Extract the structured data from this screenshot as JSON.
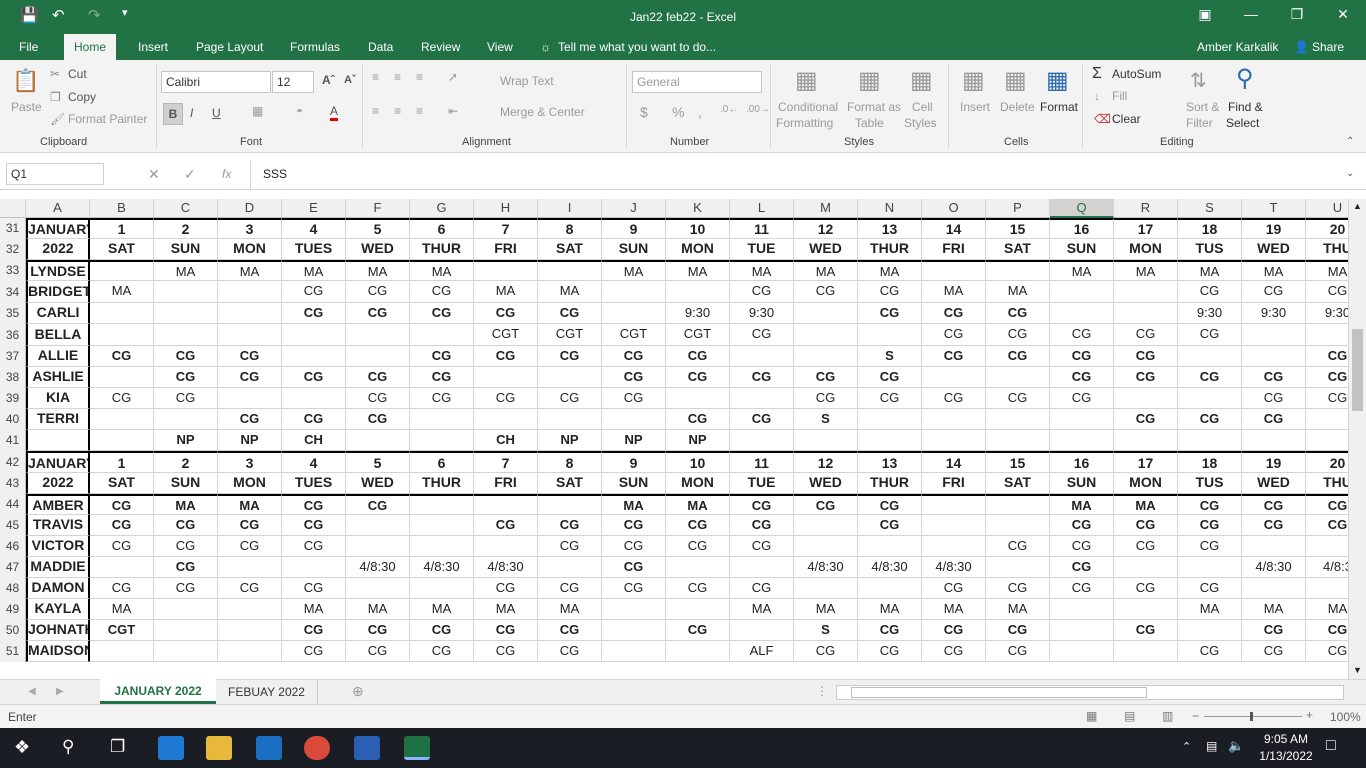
{
  "title": "Jan22 feb22 - Excel",
  "menu_tabs": [
    "File",
    "Home",
    "Insert",
    "Page Layout",
    "Formulas",
    "Data",
    "Review",
    "View"
  ],
  "tell_me": "Tell me what you want to do...",
  "user": "Amber Karkalik",
  "share": "Share",
  "clipboard": {
    "paste": "Paste",
    "cut": "Cut",
    "copy": "Copy",
    "format_painter": "Format Painter",
    "group": "Clipboard"
  },
  "font": {
    "name": "Calibri",
    "size": "12",
    "group": "Font",
    "bold": "B",
    "italic": "I",
    "underline": "U"
  },
  "alignment": {
    "wrap": "Wrap Text",
    "merge": "Merge & Center",
    "group": "Alignment"
  },
  "number": {
    "format": "General",
    "group": "Number",
    "dollar": "$",
    "percent": "%",
    "comma": ","
  },
  "styles": {
    "conditional": "Conditional",
    "formatting": "Formatting",
    "format_as": "Format as",
    "table": "Table",
    "cell": "Cell",
    "cell_styles": "Styles",
    "group": "Styles"
  },
  "cells": {
    "insert": "Insert",
    "delete": "Delete",
    "format": "Format",
    "group": "Cells"
  },
  "editing": {
    "autosum": "AutoSum",
    "fill": "Fill",
    "clear": "Clear",
    "sort": "Sort &",
    "filter": "Filter",
    "find": "Find &",
    "select": "Select",
    "group": "Editing"
  },
  "namebox": "Q1",
  "fx": "fx",
  "formula": "SSS",
  "columns": [
    "A",
    "B",
    "C",
    "D",
    "E",
    "F",
    "G",
    "H",
    "I",
    "J",
    "K",
    "L",
    "M",
    "N",
    "O",
    "P",
    "Q",
    "R",
    "S",
    "T",
    "U"
  ],
  "selected_column": "Q",
  "rows": [
    {
      "n": "31",
      "hdr": true,
      "thick": true,
      "c": [
        "JANUARY",
        "1",
        "2",
        "3",
        "4",
        "5",
        "6",
        "7",
        "8",
        "9",
        "10",
        "11",
        "12",
        "13",
        "14",
        "15",
        "16",
        "17",
        "18",
        "19",
        "20"
      ]
    },
    {
      "n": "32",
      "hdr": true,
      "c": [
        "2022",
        "SAT",
        "SUN",
        "MON",
        "TUES",
        "WED",
        "THUR",
        "FRI",
        "SAT",
        "SUN",
        "MON",
        "TUE",
        "WED",
        "THUR",
        "FRI",
        "SAT",
        "SUN",
        "MON",
        "TUS",
        "WED",
        "THU"
      ]
    },
    {
      "n": "33",
      "thick": true,
      "c": [
        "LYNDSE",
        "",
        "MA",
        "MA",
        "MA",
        "MA",
        "MA",
        "",
        "",
        "MA",
        "MA",
        "MA",
        "MA",
        "MA",
        "",
        "",
        "MA",
        "MA",
        "MA",
        "MA",
        "MA"
      ]
    },
    {
      "n": "34",
      "c": [
        "BRIDGET",
        "MA",
        "",
        "",
        "CG",
        "CG",
        "CG",
        "MA",
        "MA",
        "",
        "",
        "CG",
        "CG",
        "CG",
        "MA",
        "MA",
        "",
        "",
        "CG",
        "CG",
        "CG"
      ]
    },
    {
      "n": "35",
      "c": [
        "CARLI",
        "",
        "",
        "",
        "CG",
        "CG",
        "CG",
        "CG",
        "CG",
        "",
        "9:30",
        "9:30",
        "",
        "CG",
        "CG",
        "CG",
        "",
        "",
        "9:30",
        "9:30",
        "9:30"
      ]
    },
    {
      "n": "36",
      "c": [
        "BELLA",
        "",
        "",
        "",
        "",
        "",
        "",
        "CGT",
        "CGT",
        "CGT",
        "CGT",
        "CG",
        "",
        "",
        "CG",
        "CG",
        "CG",
        "CG",
        "CG",
        "",
        ""
      ]
    },
    {
      "n": "37",
      "c": [
        "ALLIE",
        "CG",
        "CG",
        "CG",
        "",
        "",
        "CG",
        "CG",
        "CG",
        "CG",
        "CG",
        "",
        "",
        "S",
        "CG",
        "CG",
        "CG",
        "CG",
        "",
        "",
        "CG"
      ]
    },
    {
      "n": "38",
      "c": [
        "ASHLIE",
        "",
        "CG",
        "CG",
        "CG",
        "CG",
        "CG",
        "",
        "",
        "CG",
        "CG",
        "CG",
        "CG",
        "CG",
        "",
        "",
        "CG",
        "CG",
        "CG",
        "CG",
        "CG"
      ]
    },
    {
      "n": "39",
      "c": [
        "KIA",
        "CG",
        "CG",
        "",
        "",
        "CG",
        "CG",
        "CG",
        "CG",
        "CG",
        "",
        "",
        "CG",
        "CG",
        "CG",
        "CG",
        "CG",
        "",
        "",
        "CG",
        "CG"
      ]
    },
    {
      "n": "40",
      "c": [
        "TERRI",
        "",
        "",
        "CG",
        "CG",
        "CG",
        "",
        "",
        "",
        "",
        "CG",
        "CG",
        "S",
        "",
        "",
        "",
        "",
        "CG",
        "CG",
        "CG",
        ""
      ]
    },
    {
      "n": "41",
      "c": [
        "",
        "",
        "NP",
        "NP",
        "CH",
        "",
        "",
        "CH",
        "NP",
        "NP",
        "NP",
        "",
        "",
        "",
        "",
        "",
        "",
        "",
        "",
        "",
        ""
      ]
    },
    {
      "n": "42",
      "hdr": true,
      "thick": true,
      "c": [
        "JANUARY",
        "1",
        "2",
        "3",
        "4",
        "5",
        "6",
        "7",
        "8",
        "9",
        "10",
        "11",
        "12",
        "13",
        "14",
        "15",
        "16",
        "17",
        "18",
        "19",
        "20"
      ]
    },
    {
      "n": "43",
      "hdr": true,
      "c": [
        "2022",
        "SAT",
        "SUN",
        "MON",
        "TUES",
        "WED",
        "THUR",
        "FRI",
        "SAT",
        "SUN",
        "MON",
        "TUE",
        "WED",
        "THUR",
        "FRI",
        "SAT",
        "SUN",
        "MON",
        "TUS",
        "WED",
        "THU"
      ]
    },
    {
      "n": "44",
      "thick": true,
      "c": [
        "AMBER",
        "CG",
        "MA",
        "MA",
        "CG",
        "CG",
        "",
        "",
        "",
        "MA",
        "MA",
        "CG",
        "CG",
        "CG",
        "",
        "",
        "MA",
        "MA",
        "CG",
        "CG",
        "CG"
      ]
    },
    {
      "n": "45",
      "c": [
        "TRAVIS",
        "CG",
        "CG",
        "CG",
        "CG",
        "",
        "",
        "CG",
        "CG",
        "CG",
        "CG",
        "CG",
        "",
        "CG",
        "",
        "",
        "CG",
        "CG",
        "CG",
        "CG",
        "CG"
      ]
    },
    {
      "n": "46",
      "c": [
        "VICTOR",
        "CG",
        "CG",
        "CG",
        "CG",
        "",
        "",
        "",
        "CG",
        "CG",
        "CG",
        "CG",
        "",
        "",
        "",
        "CG",
        "CG",
        "CG",
        "CG",
        "",
        ""
      ]
    },
    {
      "n": "47",
      "c": [
        "MADDIE",
        "",
        "CG",
        "",
        "",
        "4/8:30",
        "4/8:30",
        "4/8:30",
        "",
        "CG",
        "",
        "",
        "4/8:30",
        "4/8:30",
        "4/8:30",
        "",
        "CG",
        "",
        "",
        "4/8:30",
        "4/8:3"
      ]
    },
    {
      "n": "48",
      "c": [
        "DAMON",
        "CG",
        "CG",
        "CG",
        "CG",
        "",
        "",
        "CG",
        "CG",
        "CG",
        "CG",
        "CG",
        "",
        "",
        "CG",
        "CG",
        "CG",
        "CG",
        "CG",
        "",
        ""
      ]
    },
    {
      "n": "49",
      "c": [
        "KAYLA",
        "MA",
        "",
        "",
        "MA",
        "MA",
        "MA",
        "MA",
        "MA",
        "",
        "",
        "MA",
        "MA",
        "MA",
        "MA",
        "MA",
        "",
        "",
        "MA",
        "MA",
        "MA"
      ]
    },
    {
      "n": "50",
      "c": [
        "JOHNATH",
        "CGT",
        "",
        "",
        "CG",
        "CG",
        "CG",
        "CG",
        "CG",
        "",
        "CG",
        "",
        "S",
        "CG",
        "CG",
        "CG",
        "",
        "CG",
        "",
        "CG",
        "CG"
      ]
    },
    {
      "n": "51",
      "c": [
        "MAIDSON",
        "",
        "",
        "",
        "CG",
        "CG",
        "CG",
        "CG",
        "CG",
        "",
        "",
        "ALF",
        "CG",
        "CG",
        "CG",
        "CG",
        "",
        "",
        "CG",
        "CG",
        "CG"
      ]
    }
  ],
  "sheets": [
    "JANUARY 2022",
    "FEBUAY 2022"
  ],
  "status": "Enter",
  "zoom": "100%",
  "clock": {
    "time": "9:05 AM",
    "date": "1/13/2022"
  }
}
